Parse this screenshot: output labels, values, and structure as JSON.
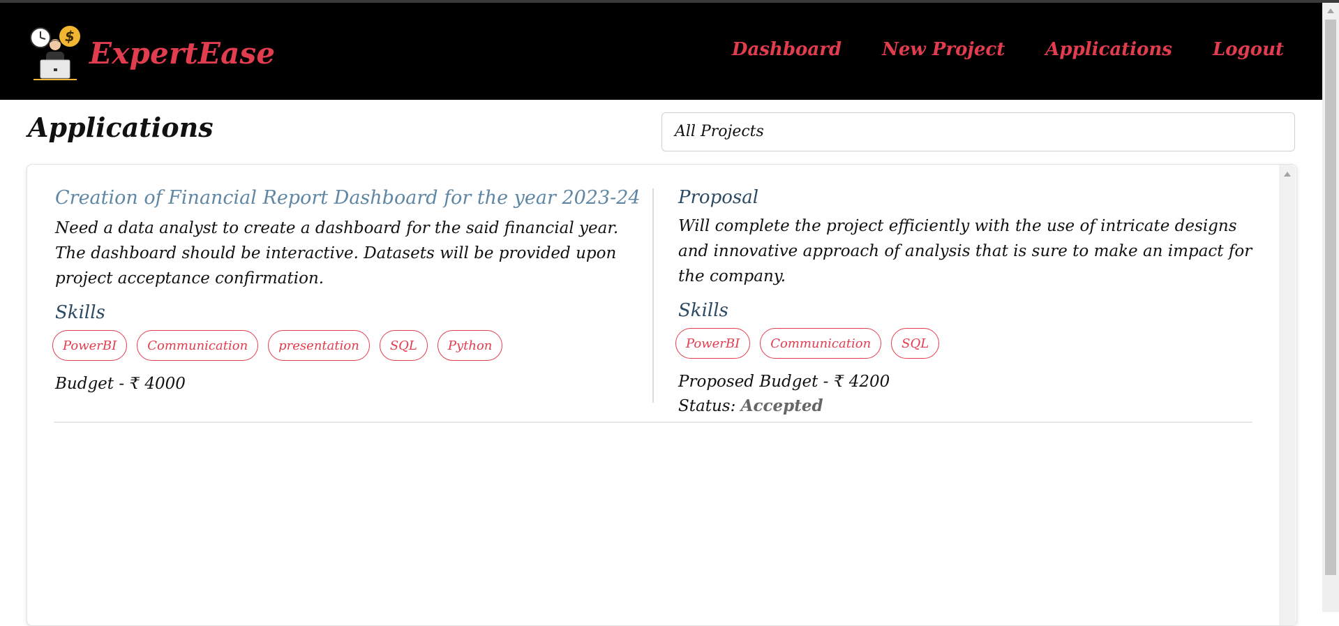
{
  "brand": {
    "name": "ExpertEase",
    "logo_icon": "freelancer-desk-logo-icon",
    "accent": "#e23c4f"
  },
  "nav": {
    "items": [
      {
        "label": "Dashboard"
      },
      {
        "label": "New Project"
      },
      {
        "label": "Applications"
      },
      {
        "label": "Logout"
      }
    ]
  },
  "page": {
    "title": "Applications",
    "filter": {
      "selected": "All Projects"
    }
  },
  "application": {
    "project": {
      "title": "Creation of Financial Report Dashboard for the year 2023-24",
      "description": "Need a data analyst to create a dashboard for the said financial year. The dashboard should be interactive. Datasets will be provided upon project acceptance confirmation.",
      "skills_label": "Skills",
      "skills": [
        "PowerBI",
        "Communication",
        "presentation",
        "SQL",
        "Python"
      ],
      "budget": "Budget - ₹ 4000"
    },
    "proposal": {
      "title": "Proposal",
      "text": "Will complete the project efficiently with the use of intricate designs and innovative approach of analysis that is sure to make an impact for the company.",
      "skills_label": "Skills",
      "skills": [
        "PowerBI",
        "Communication",
        "SQL"
      ],
      "budget": "Proposed Budget - ₹ 4200",
      "status_label": "Status:",
      "status_value": "Accepted"
    }
  }
}
